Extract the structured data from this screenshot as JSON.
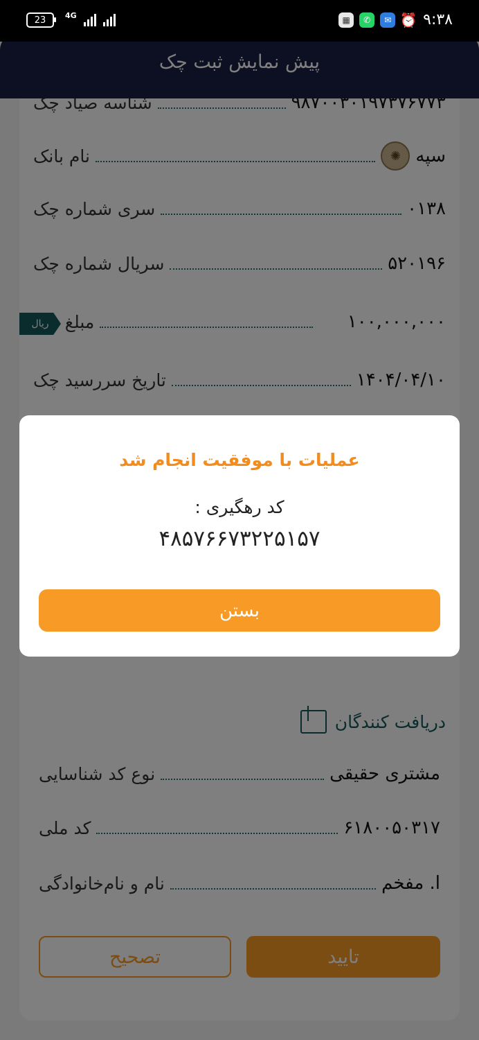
{
  "status_bar": {
    "battery": "23",
    "network": "4G",
    "time": "۹:۳۸"
  },
  "header": {
    "title": "پیش نمایش ثبت چک"
  },
  "details": [
    {
      "label": "شناسه صیاد چک",
      "value": "۹۸۷۰۰۳۰۱۹۷۳۷۶۷۷۳"
    },
    {
      "label": "نام بانک",
      "value": "سپه"
    },
    {
      "label": "سری شماره چک",
      "value": "۰۱۳۸"
    },
    {
      "label": "سریال شماره چک",
      "value": "۵۲۰۱۹۶"
    },
    {
      "label": "مبلغ چک",
      "value": "۱۰۰,۰۰۰,۰۰۰",
      "unit": "ریال"
    },
    {
      "label": "تاریخ سررسید چک",
      "value": "۱۴۰۴/۰۴/۱۰"
    }
  ],
  "receivers": {
    "title": "دریافت کنندگان",
    "rows": [
      {
        "label": "نوع کد شناسایی",
        "value": "مشتری حقیقی"
      },
      {
        "label": "کد ملی",
        "value": "۶۱۸۰۰۵۰۳۱۷"
      },
      {
        "label": "نام و نام‌خانوادگی",
        "value": "ا. مفخم"
      }
    ]
  },
  "buttons": {
    "confirm": "تایید",
    "edit": "تصحیح"
  },
  "dialog": {
    "title": "عملیات با موفقیت انجام شد",
    "code_label": "کد رهگیری :",
    "code_value": "۴۸۵۷۶۶۷۳۲۲۵۱۵۷",
    "close_label": "بستن"
  },
  "colors": {
    "header": "#1a1f45",
    "accent": "#f79a26",
    "teal": "#16595b"
  }
}
